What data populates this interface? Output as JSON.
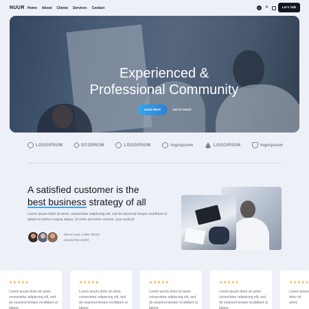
{
  "nav": {
    "logo": "NUUR",
    "items": [
      "Home",
      "About",
      "Clients",
      "Services",
      "Contact"
    ],
    "cta": "Let's Talk",
    "socials": [
      "facebook-icon",
      "x-icon",
      "instagram-icon"
    ]
  },
  "hero": {
    "title_line1": "Experienced &",
    "title_line2": "Professional Community",
    "primary_button": "Learn More",
    "secondary_button": "Get In Touch"
  },
  "logos": [
    "LOGOIPSUM",
    "OCORRUM",
    "LOGOIPSUM",
    "logoipsum",
    "LOGOIPSUM",
    "logoipsum"
  ],
  "about": {
    "heading_line1": "A satisfied customer is the",
    "heading_highlight": "best business",
    "heading_rest": " strategy of all",
    "paragraph": "Lorem ipsum dolor sit amet, consectetur adipiscing elit, sed do eiusmod tempor incididunt ut labore et dolore magna aliqua. Ut enim ad minim veniam, quis nostrud",
    "clients_text": "We've over 4.000 clients around the world"
  },
  "testimonials": [
    {
      "stars": "★★★★★",
      "text": "Lorem ipsum dolor sit amet, consectetur adipiscing elit, sed do eiusmod tempor incididunt ut labore"
    },
    {
      "stars": "★★★★★",
      "text": "Lorem ipsum dolor sit amet, consectetur adipiscing elit, sed do eiusmod tempor incididunt ut labore"
    },
    {
      "stars": "★★★★★",
      "text": "Lorem ipsum dolor sit amet, consectetur adipiscing elit, sed do eiusmod tempor incididunt ut labore"
    },
    {
      "stars": "★★★★★",
      "text": "Lorem ipsum dolor sit amet, consectetur adipiscing elit, sed do eiusmod tempor incididunt ut labore"
    },
    {
      "stars": "★★★★★",
      "text": "Lorem ipsum dolor sit amet, consectetur adipiscing elit, sed do eiusmod tempor incididunt ut labore"
    }
  ],
  "colors": {
    "accent": "#3aa7e6",
    "background": "#eef0f7",
    "dark": "#15161c",
    "star": "#f2a93b"
  }
}
